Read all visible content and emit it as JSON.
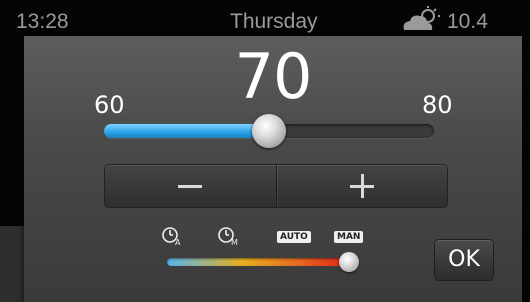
{
  "statusbar": {
    "time": "13:28",
    "day": "Thursday",
    "weather_icon": "partly-cloudy-icon",
    "temperature": "10.4"
  },
  "thermostat": {
    "setpoint": "70",
    "range_min": "60",
    "range_max": "80",
    "slider_value": 70,
    "slider_min": 60,
    "slider_max": 80,
    "accent_color": "#2aa2e8"
  },
  "stepper": {
    "decrease_icon": "minus-icon",
    "increase_icon": "plus-icon"
  },
  "modes": {
    "items": [
      {
        "label": "",
        "icon": "clock-a-icon"
      },
      {
        "label": "",
        "icon": "clock-m-icon"
      },
      {
        "label": "AUTO",
        "icon": "auto-badge"
      },
      {
        "label": "MAN",
        "icon": "man-badge"
      }
    ],
    "selected_index": 3,
    "selected_fraction": 1.0
  },
  "actions": {
    "ok_label": "OK"
  }
}
